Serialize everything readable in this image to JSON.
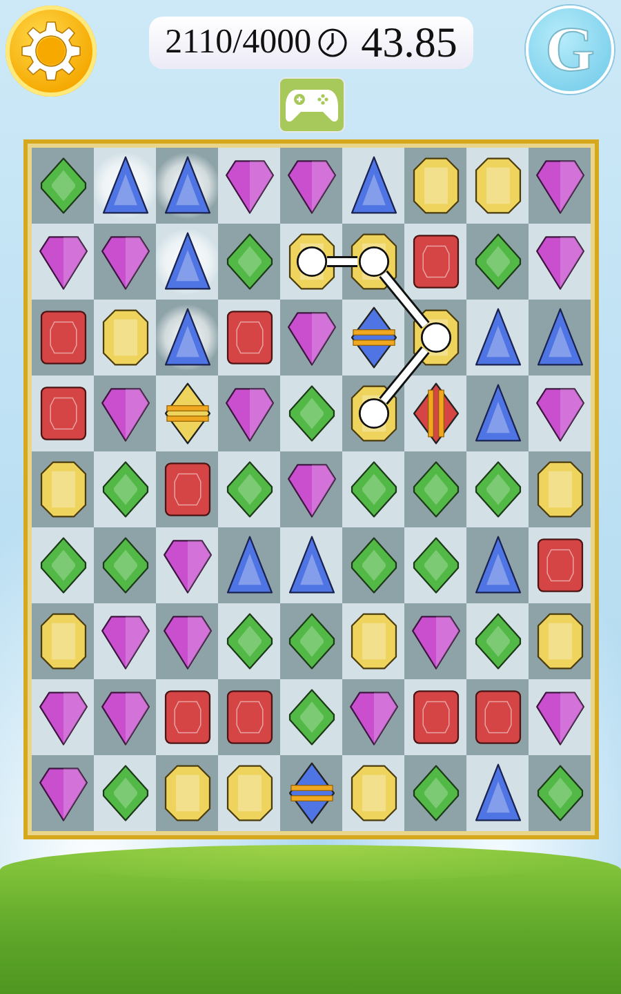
{
  "header": {
    "score": "2110/4000",
    "timer": "43.85",
    "profile_button": {
      "label": "G"
    }
  },
  "board": {
    "rows": [
      {
        "cells": [
          {
            "kind": "diamond",
            "color": "#52b946",
            "selected": false,
            "hint": false
          },
          {
            "kind": "triangle",
            "color": "#4f74e3",
            "selected": false,
            "hint": true
          },
          {
            "kind": "triangle",
            "color": "#4f74e3",
            "selected": false,
            "hint": true
          },
          {
            "kind": "shield",
            "color": "#c94fcf",
            "selected": false,
            "hint": false
          },
          {
            "kind": "shield",
            "color": "#c94fcf",
            "selected": false,
            "hint": false
          },
          {
            "kind": "triangle",
            "color": "#4f74e3",
            "selected": false,
            "hint": false
          },
          {
            "kind": "octagon",
            "color": "#eed35c",
            "selected": false,
            "hint": false
          },
          {
            "kind": "octagon",
            "color": "#eed35c",
            "selected": false,
            "hint": false
          },
          {
            "kind": "shield",
            "color": "#c94fcf",
            "selected": false,
            "hint": false
          }
        ]
      },
      {
        "cells": [
          {
            "kind": "shield",
            "color": "#c94fcf",
            "selected": false,
            "hint": false
          },
          {
            "kind": "shield",
            "color": "#c94fcf",
            "selected": false,
            "hint": false
          },
          {
            "kind": "triangle",
            "color": "#4f74e3",
            "selected": false,
            "hint": true
          },
          {
            "kind": "diamond",
            "color": "#52b946",
            "selected": false,
            "hint": false
          },
          {
            "kind": "octagon",
            "color": "#eed35c",
            "selected": true,
            "hint": false
          },
          {
            "kind": "octagon",
            "color": "#eed35c",
            "selected": true,
            "hint": false
          },
          {
            "kind": "square",
            "color": "#d64545",
            "selected": false,
            "hint": false
          },
          {
            "kind": "diamond",
            "color": "#52b946",
            "selected": false,
            "hint": false
          },
          {
            "kind": "shield",
            "color": "#c94fcf",
            "selected": false,
            "hint": false
          }
        ]
      },
      {
        "cells": [
          {
            "kind": "square",
            "color": "#d64545",
            "selected": false,
            "hint": false
          },
          {
            "kind": "octagon",
            "color": "#eed35c",
            "selected": false,
            "hint": false
          },
          {
            "kind": "triangle",
            "color": "#4f74e3",
            "selected": false,
            "hint": true
          },
          {
            "kind": "square",
            "color": "#d64545",
            "selected": false,
            "hint": false
          },
          {
            "kind": "shield",
            "color": "#c94fcf",
            "selected": false,
            "hint": false
          },
          {
            "kind": "banded_h",
            "color": "#4f74e3",
            "selected": false,
            "hint": false
          },
          {
            "kind": "octagon",
            "color": "#eed35c",
            "selected": true,
            "hint": false
          },
          {
            "kind": "triangle",
            "color": "#4f74e3",
            "selected": false,
            "hint": false
          },
          {
            "kind": "triangle",
            "color": "#4f74e3",
            "selected": false,
            "hint": false
          }
        ]
      },
      {
        "cells": [
          {
            "kind": "square",
            "color": "#d64545",
            "selected": false,
            "hint": false
          },
          {
            "kind": "shield",
            "color": "#c94fcf",
            "selected": false,
            "hint": false
          },
          {
            "kind": "banded_h",
            "color": "#eed35c",
            "selected": false,
            "hint": false
          },
          {
            "kind": "shield",
            "color": "#c94fcf",
            "selected": false,
            "hint": false
          },
          {
            "kind": "diamond",
            "color": "#52b946",
            "selected": false,
            "hint": false
          },
          {
            "kind": "octagon",
            "color": "#eed35c",
            "selected": true,
            "hint": false
          },
          {
            "kind": "banded_v",
            "color": "#d64545",
            "selected": false,
            "hint": false
          },
          {
            "kind": "triangle",
            "color": "#4f74e3",
            "selected": false,
            "hint": false
          },
          {
            "kind": "shield",
            "color": "#c94fcf",
            "selected": false,
            "hint": false
          }
        ]
      },
      {
        "cells": [
          {
            "kind": "octagon",
            "color": "#eed35c",
            "selected": false,
            "hint": false
          },
          {
            "kind": "diamond",
            "color": "#52b946",
            "selected": false,
            "hint": false
          },
          {
            "kind": "square",
            "color": "#d64545",
            "selected": false,
            "hint": false
          },
          {
            "kind": "diamond",
            "color": "#52b946",
            "selected": false,
            "hint": false
          },
          {
            "kind": "shield",
            "color": "#c94fcf",
            "selected": false,
            "hint": false
          },
          {
            "kind": "diamond",
            "color": "#52b946",
            "selected": false,
            "hint": false
          },
          {
            "kind": "diamond",
            "color": "#52b946",
            "selected": false,
            "hint": false
          },
          {
            "kind": "diamond",
            "color": "#52b946",
            "selected": false,
            "hint": false
          },
          {
            "kind": "octagon",
            "color": "#eed35c",
            "selected": false,
            "hint": false
          }
        ]
      },
      {
        "cells": [
          {
            "kind": "diamond",
            "color": "#52b946",
            "selected": false,
            "hint": false
          },
          {
            "kind": "diamond",
            "color": "#52b946",
            "selected": false,
            "hint": false
          },
          {
            "kind": "shield",
            "color": "#c94fcf",
            "selected": false,
            "hint": false
          },
          {
            "kind": "triangle",
            "color": "#4f74e3",
            "selected": false,
            "hint": false
          },
          {
            "kind": "triangle",
            "color": "#4f74e3",
            "selected": false,
            "hint": false
          },
          {
            "kind": "diamond",
            "color": "#52b946",
            "selected": false,
            "hint": false
          },
          {
            "kind": "diamond",
            "color": "#52b946",
            "selected": false,
            "hint": false
          },
          {
            "kind": "triangle",
            "color": "#4f74e3",
            "selected": false,
            "hint": false
          },
          {
            "kind": "square",
            "color": "#d64545",
            "selected": false,
            "hint": false
          }
        ]
      },
      {
        "cells": [
          {
            "kind": "octagon",
            "color": "#eed35c",
            "selected": false,
            "hint": false
          },
          {
            "kind": "shield",
            "color": "#c94fcf",
            "selected": false,
            "hint": false
          },
          {
            "kind": "shield",
            "color": "#c94fcf",
            "selected": false,
            "hint": false
          },
          {
            "kind": "diamond",
            "color": "#52b946",
            "selected": false,
            "hint": false
          },
          {
            "kind": "diamond",
            "color": "#52b946",
            "selected": false,
            "hint": false
          },
          {
            "kind": "octagon",
            "color": "#eed35c",
            "selected": false,
            "hint": false
          },
          {
            "kind": "shield",
            "color": "#c94fcf",
            "selected": false,
            "hint": false
          },
          {
            "kind": "diamond",
            "color": "#52b946",
            "selected": false,
            "hint": false
          },
          {
            "kind": "octagon",
            "color": "#eed35c",
            "selected": false,
            "hint": false
          }
        ]
      },
      {
        "cells": [
          {
            "kind": "shield",
            "color": "#c94fcf",
            "selected": false,
            "hint": false
          },
          {
            "kind": "shield",
            "color": "#c94fcf",
            "selected": false,
            "hint": false
          },
          {
            "kind": "square",
            "color": "#d64545",
            "selected": false,
            "hint": false
          },
          {
            "kind": "square",
            "color": "#d64545",
            "selected": false,
            "hint": false
          },
          {
            "kind": "diamond",
            "color": "#52b946",
            "selected": false,
            "hint": false
          },
          {
            "kind": "shield",
            "color": "#c94fcf",
            "selected": false,
            "hint": false
          },
          {
            "kind": "square",
            "color": "#d64545",
            "selected": false,
            "hint": false
          },
          {
            "kind": "square",
            "color": "#d64545",
            "selected": false,
            "hint": false
          },
          {
            "kind": "shield",
            "color": "#c94fcf",
            "selected": false,
            "hint": false
          }
        ]
      },
      {
        "cells": [
          {
            "kind": "shield",
            "color": "#c94fcf",
            "selected": false,
            "hint": false
          },
          {
            "kind": "diamond",
            "color": "#52b946",
            "selected": false,
            "hint": false
          },
          {
            "kind": "octagon",
            "color": "#eed35c",
            "selected": false,
            "hint": false
          },
          {
            "kind": "octagon",
            "color": "#eed35c",
            "selected": false,
            "hint": false
          },
          {
            "kind": "banded_h",
            "color": "#4f74e3",
            "selected": false,
            "hint": false
          },
          {
            "kind": "octagon",
            "color": "#eed35c",
            "selected": false,
            "hint": false
          },
          {
            "kind": "diamond",
            "color": "#52b946",
            "selected": false,
            "hint": false
          },
          {
            "kind": "triangle",
            "color": "#4f74e3",
            "selected": false,
            "hint": false
          },
          {
            "kind": "diamond",
            "color": "#52b946",
            "selected": false,
            "hint": false
          }
        ]
      }
    ]
  }
}
